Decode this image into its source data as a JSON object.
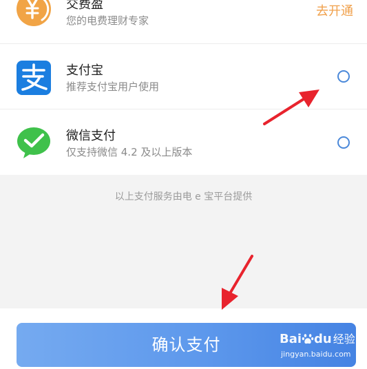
{
  "payment_methods": [
    {
      "id": "jiaofeiying",
      "icon": "yen-coin-icon",
      "title": "交费盈",
      "subtitle": "您的电费理财专家",
      "action": "去开通"
    },
    {
      "id": "alipay",
      "icon": "alipay-icon",
      "title": "支付宝",
      "subtitle": "推荐支付宝用户使用",
      "selected": false
    },
    {
      "id": "wechat",
      "icon": "wechat-pay-icon",
      "title": "微信支付",
      "subtitle": "仅支持微信 4.2 及以上版本",
      "selected": false
    }
  ],
  "notice": "以上支付服务由电 e 宝平台提供",
  "confirm_button": "确认支付",
  "watermark": {
    "brand_left": "Bai",
    "brand_right": "du",
    "suffix": "经验",
    "url": "jingyan.baidu.com"
  },
  "colors": {
    "accent_blue": "#4a88d9",
    "link_orange": "#f0a04b",
    "alipay_blue": "#1b7ee0",
    "wechat_green": "#3fc14b",
    "coin_orange": "#f1a446",
    "annotation_red": "#e8232d"
  }
}
